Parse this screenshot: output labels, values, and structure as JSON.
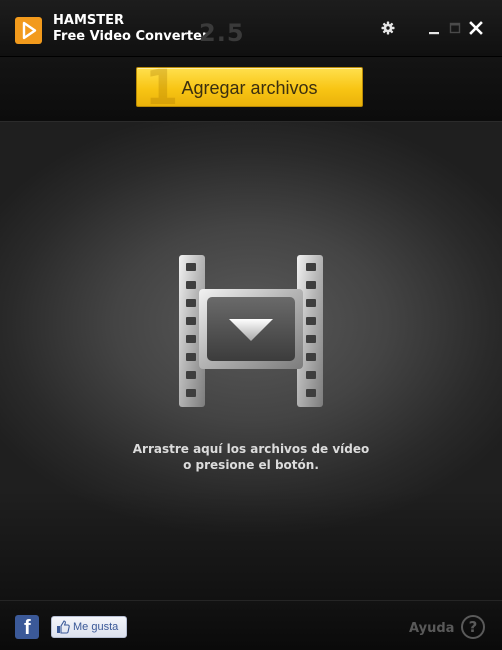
{
  "app": {
    "name": "HAMSTER",
    "subtitle": "Free Video Converter",
    "version": "2.5"
  },
  "window_controls": {
    "settings_icon": "gear-icon",
    "minimize_icon": "minimize-icon",
    "maximize_icon": "maximize-icon",
    "close_icon": "close-icon"
  },
  "toolbar": {
    "step_number": "1",
    "add_files_label": "Agregar archivos"
  },
  "drop_area": {
    "icon": "film-strip-download-icon",
    "hint_line1": "Arrastre aquí los archivos de vídeo",
    "hint_line2": "o presione el botón."
  },
  "footer": {
    "facebook_icon": "facebook-icon",
    "like_label": "Me gusta",
    "help_label": "Ayuda",
    "help_icon": "question-icon"
  },
  "colors": {
    "accent": "#f29a1c",
    "button_yellow": "#f8c514",
    "facebook_blue": "#3b5998"
  }
}
